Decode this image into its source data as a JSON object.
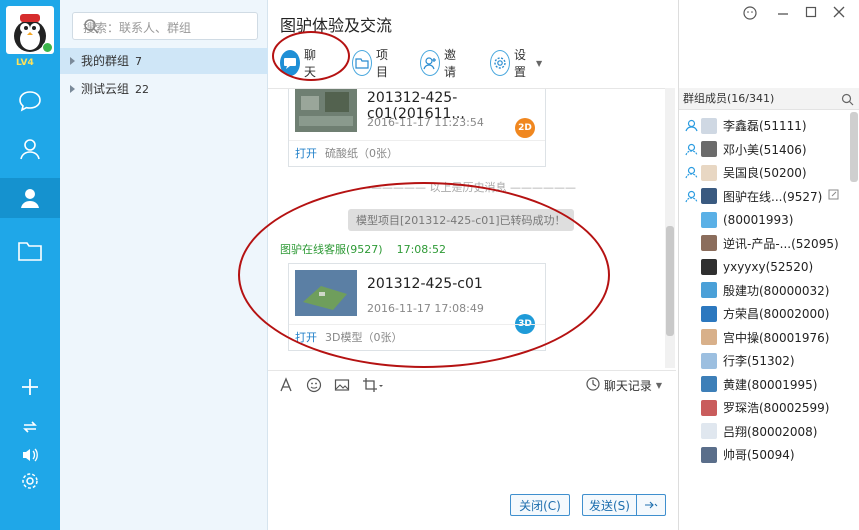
{
  "user": {
    "level": "LV4"
  },
  "search": {
    "placeholder": "搜索：联系人、群组"
  },
  "groups": [
    {
      "name": "我的群组",
      "count": "7"
    },
    {
      "name": "测试云组",
      "count": "22"
    }
  ],
  "chat": {
    "title": "图驴体验及交流",
    "toolbar": [
      {
        "label": "聊天",
        "icon": "chat-icon"
      },
      {
        "label": "项目",
        "icon": "folder-icon"
      },
      {
        "label": "邀请",
        "icon": "invite-icon"
      },
      {
        "label": "设置",
        "icon": "gear-icon"
      }
    ],
    "card1": {
      "name": "201312-425-c01(201611...",
      "date": "2016-11-17 11:23:54",
      "open": "打开",
      "meta": "硫酸纸（0张）",
      "badge": "2D"
    },
    "separator": "以上是历史消息",
    "system_msg": "模型项目[201312-425-c01]已转码成功！",
    "sender": "图驴在线客服(9527)",
    "sender_time": "17:08:52",
    "card2": {
      "name": "201312-425-c01",
      "date": "2016-11-17 17:08:49",
      "open": "打开",
      "meta": "3D模型（0张）",
      "badge": "3D"
    },
    "history_label": "聊天记录",
    "close_btn": "关闭(C)",
    "send_btn": "发送(S)"
  },
  "members": {
    "header": "群组成员(16/341)",
    "list": [
      {
        "name": "李鑫磊(51111)",
        "role": "owner"
      },
      {
        "name": "邓小美(51406)",
        "role": "admin"
      },
      {
        "name": "吴国良(50200)",
        "role": "admin"
      },
      {
        "name": "图驴在线...(9527)",
        "role": "admin"
      },
      {
        "name": "(80001993)",
        "role": "member"
      },
      {
        "name": "逆讯-产品-...(52095)",
        "role": "member"
      },
      {
        "name": "yxyyxy(52520)",
        "role": "member"
      },
      {
        "name": "殷建功(80000032)",
        "role": "member"
      },
      {
        "name": "方荣昌(80002000)",
        "role": "member"
      },
      {
        "name": "宫中操(80001976)",
        "role": "member"
      },
      {
        "name": "行李(51302)",
        "role": "member"
      },
      {
        "name": "黄建(80001995)",
        "role": "member"
      },
      {
        "name": "罗琛浩(80002599)",
        "role": "member"
      },
      {
        "name": "吕翔(80002008)",
        "role": "member"
      },
      {
        "name": "帅哥(50094)",
        "role": "member"
      }
    ]
  },
  "colors": {
    "rail": "#1fa7e8",
    "accent": "#1f8fd6",
    "annotation": "#b51212",
    "sender": "#2e9a36"
  }
}
